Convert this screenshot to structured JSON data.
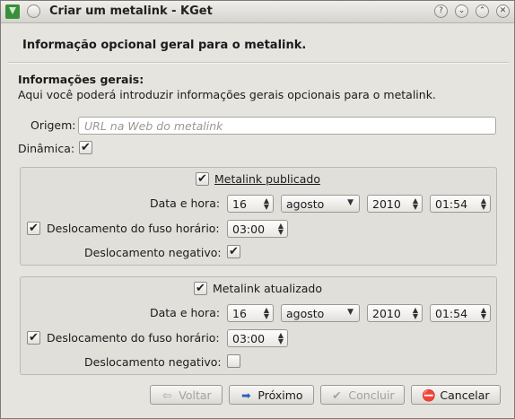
{
  "window": {
    "title": "Criar um metalink - KGet"
  },
  "titlebar_buttons": [
    "?",
    "⌄",
    "⌃",
    "✕"
  ],
  "page": {
    "heading": "Informação opcional geral para o metalink.",
    "section_title": "Informações gerais:",
    "section_desc": "Aqui você poderá introduzir informações gerais opcionais para o metalink.",
    "origin_label": "Origem:",
    "origin_placeholder": "URL na Web do metalink",
    "dynamic_label": "Dinâmica:"
  },
  "published": {
    "title": "Metalink publicado",
    "datetime_label": "Data e hora:",
    "day": "16",
    "month": "agosto",
    "year": "2010",
    "time": "01:54",
    "tz_label": "Deslocamento do fuso horário:",
    "tz_value": "03:00",
    "neg_label": "Deslocamento negativo:",
    "checked": true,
    "tz_checked": true,
    "neg_checked": true
  },
  "updated": {
    "title": "Metalink atualizado",
    "datetime_label": "Data e hora:",
    "day": "16",
    "month": "agosto",
    "year": "2010",
    "time": "01:54",
    "tz_label": "Deslocamento do fuso horário:",
    "tz_value": "03:00",
    "neg_label": "Deslocamento negativo:",
    "checked": true,
    "tz_checked": true,
    "neg_checked": false
  },
  "buttons": {
    "back": "Voltar",
    "next": "Próximo",
    "finish": "Concluir",
    "cancel": "Cancelar"
  },
  "check_glyph": "✔",
  "colors": {
    "cancel_icon": "#d42020",
    "next_icon": "#2a5fb8",
    "window_bg": "#e6e4df"
  }
}
